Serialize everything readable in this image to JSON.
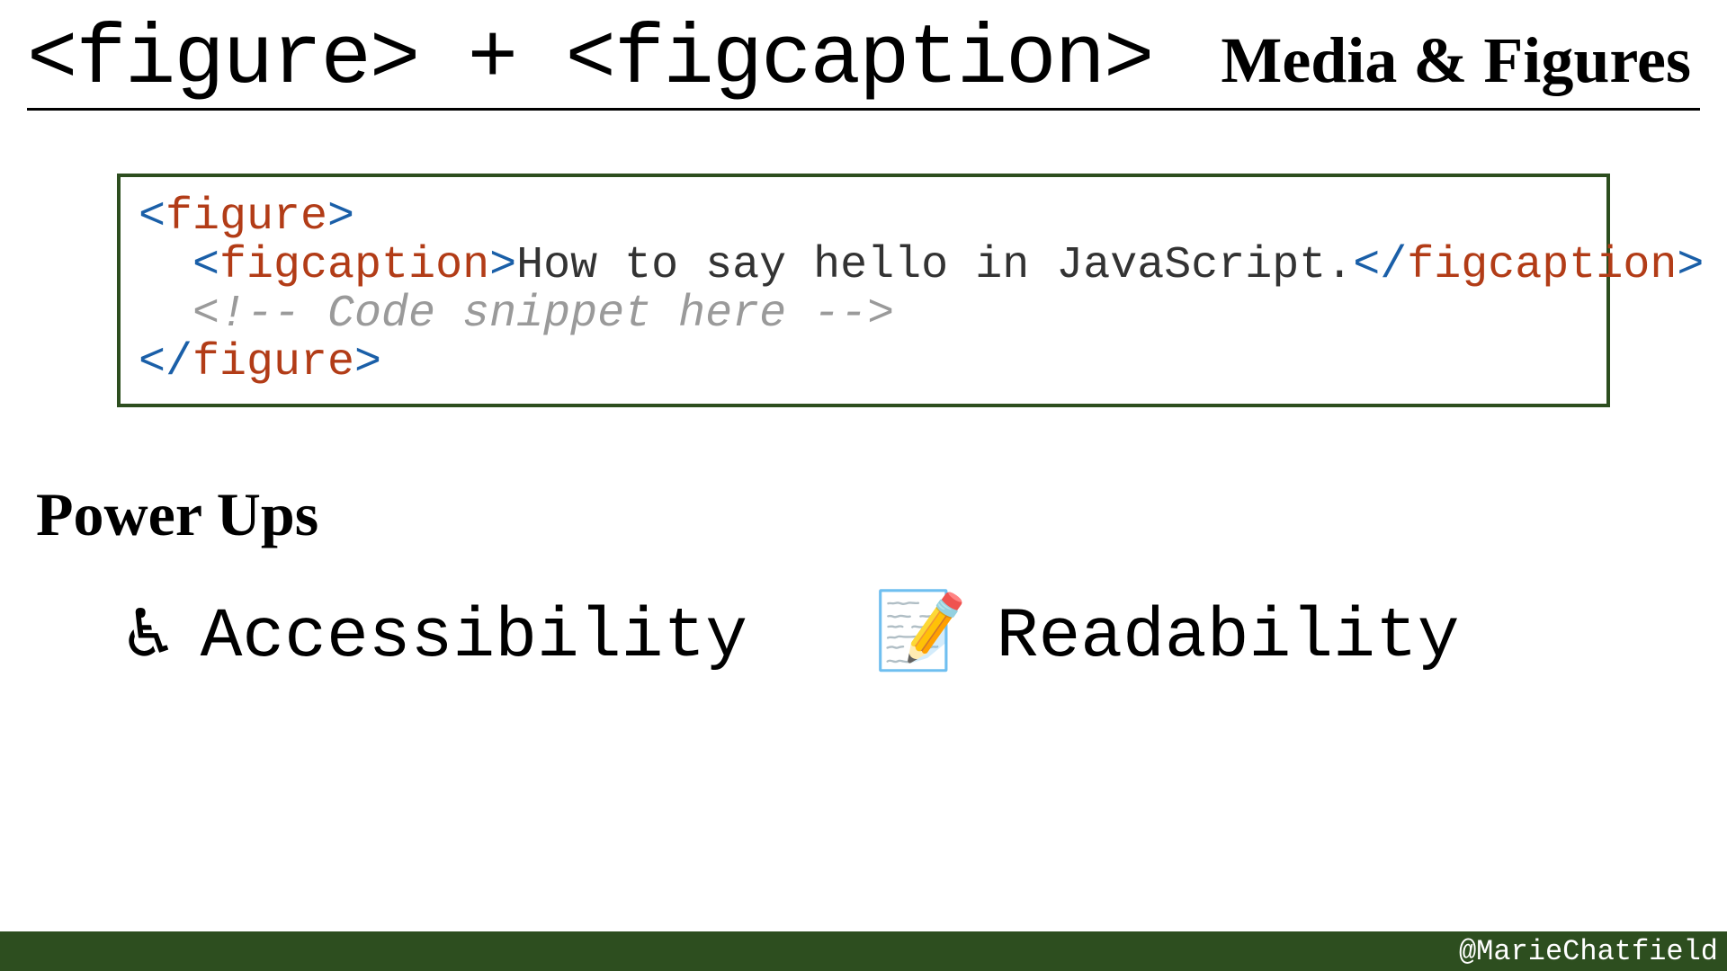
{
  "header": {
    "title": "<figure> + <figcaption>",
    "subtitle": "Media & Figures"
  },
  "code": {
    "line1_open_bracket": "<",
    "line1_tag": "figure",
    "line1_close_bracket": ">",
    "line2_indent": "  ",
    "line2_open_bracket": "<",
    "line2_tag": "figcaption",
    "line2_close_bracket": ">",
    "line2_text": "How to say hello in JavaScript.",
    "line2_end_open": "</",
    "line2_end_tag": "figcaption",
    "line2_end_close": ">",
    "line3_indent": "  ",
    "line3_comment": "<!-- Code snippet here -->",
    "line4_open": "</",
    "line4_tag": "figure",
    "line4_close": ">"
  },
  "section_title": "Power Ups",
  "powerups": [
    {
      "emoji": "♿",
      "label": "Accessibility"
    },
    {
      "emoji": "📝",
      "label": "Readability"
    }
  ],
  "footer": "@MarieChatfield"
}
